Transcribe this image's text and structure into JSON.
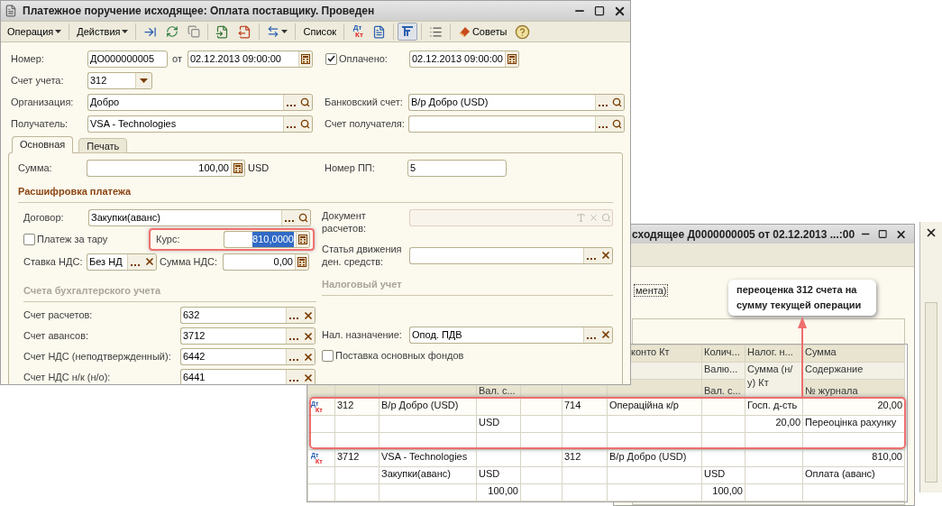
{
  "main_window": {
    "title": "Платежное поручение исходящее: Оплата поставщику. Проведен",
    "toolbar": {
      "operation": "Операция",
      "actions": "Действия",
      "list": "Список",
      "dt": "Дт",
      "kt": "Кт",
      "tips": "Советы",
      "structure_on": true
    },
    "number": {
      "label": "Номер:",
      "value": "ДО000000005"
    },
    "date": {
      "label": "от",
      "value": "02.12.2013 09:00:00"
    },
    "paid": {
      "label": "Оплачено:",
      "checked": true,
      "value": "02.12.2013 09:00:00"
    },
    "account": {
      "label": "Счет учета:",
      "value": "312"
    },
    "organization": {
      "label": "Организация:",
      "value": "Добро"
    },
    "bank_account": {
      "label": "Банковский счет:",
      "value": "В/р Добро (USD)"
    },
    "recipient": {
      "label": "Получатель:",
      "value": "VSA - Technologies"
    },
    "recipient_account": {
      "label": "Счет получателя:"
    },
    "tabs": [
      {
        "label": "Основная",
        "selected": true
      },
      {
        "label": "Печать",
        "selected": false
      }
    ],
    "sum": {
      "label": "Сумма:",
      "value": "100,00",
      "currency": "USD"
    },
    "pp_number": {
      "label": "Номер ПП:",
      "value": "5"
    },
    "payment_section": "Расшифровка платежа",
    "contract": {
      "label": "Договор:",
      "value": "Закупки(аванс)"
    },
    "tare": {
      "label": "Платеж за тару",
      "checked": false
    },
    "rate": {
      "label": "Курс:",
      "value": "810,0000",
      "highlighted": true
    },
    "vat_rate": {
      "label": "Ставка НДС:",
      "value": "Без НД"
    },
    "vat_sum": {
      "label": "Сумма НДС:",
      "value": "0,00"
    },
    "settlement_doc": {
      "label": "Документ расчетов:",
      "disabled": true
    },
    "cash_flow": {
      "label": "Статья движения ден. средств:"
    },
    "tax_section": "Налоговый учет",
    "accounts_section": "Счета бухгалтерского учета",
    "accounts": [
      {
        "label": "Счет расчетов:",
        "value": "632"
      },
      {
        "label": "Счет авансов:",
        "value": "3712"
      },
      {
        "label": "Счет НДС (неподтвержденный):",
        "value": "6442"
      },
      {
        "label": "Счет НДС н/к (н/о):",
        "value": "6441"
      }
    ],
    "tax_purpose": {
      "label": "Нал. назначение:",
      "value": "Опод. ПДВ"
    },
    "fixed_assets": {
      "label": "Поставка основных фондов",
      "checked": false
    }
  },
  "second_window": {
    "title": "сходящее Д0000000005 от 02.12.2013 ...:00",
    "link": "мента)"
  },
  "callout": "переоценка 312 счета на сумму текущей операции",
  "postings": {
    "header": [
      {
        "column_7": "конто Кт",
        "column_8": "Колич...",
        "column_9": "Налог. н...",
        "column_10": "Сумма"
      },
      {
        "column_8": "Валю...",
        "column_9": {
          "text": "Сумма (н/у) Кт",
          "kind": "tall"
        },
        "column_10": "Содержание"
      },
      {
        "column_4": "Вал. с...",
        "column_8": "Вал. с...",
        "column_10": "№ журнала"
      }
    ],
    "groups": [
      {
        "highlighted": true,
        "dt": "Дт",
        "kt": "Кт",
        "lines": [
          {
            "column_2": "312",
            "column_3": "В/р Добро (USD)",
            "column_6": "714",
            "column_7": "Операційна к/р",
            "column_9": "Госп. д-сть",
            "column_10": "20,00"
          },
          {
            "column_4": "USD",
            "column_9": "20,00",
            "column_10": "Переоцінка рахунку"
          }
        ]
      },
      {
        "highlighted": false,
        "dt": "Дт",
        "kt": "Кт",
        "lines": [
          {
            "column_2": "3712",
            "column_3": "VSA - Technologies",
            "column_6": "312",
            "column_7": "В/р Добро (USD)",
            "column_10": "810,00"
          },
          {
            "column_3": "Закупки(аванс)",
            "column_4": "USD",
            "column_8": "USD",
            "column_10": "Оплата (аванс)"
          },
          {
            "column_4": "100,00",
            "column_8": "100,00"
          }
        ]
      }
    ]
  }
}
